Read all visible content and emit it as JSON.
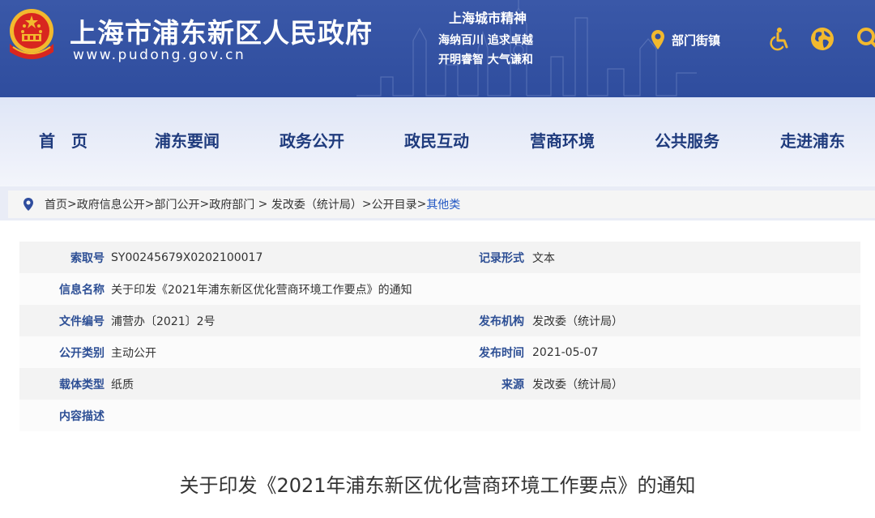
{
  "header": {
    "site_title": "上海市浦东新区人民政府",
    "site_url": "www.pudong.gov.cn",
    "spirit_title": "上海城市精神",
    "spirit_line1": "海纳百川  追求卓越",
    "spirit_line2": "开明睿智  大气谦和",
    "dept_label": "部门街镇",
    "icons": [
      "location-pin-icon",
      "accessibility-icon",
      "globe-icon",
      "search-icon"
    ]
  },
  "nav": {
    "items": [
      "首　页",
      "浦东要闻",
      "政务公开",
      "政民互动",
      "营商环境",
      "公共服务",
      "走进浦东"
    ]
  },
  "breadcrumb": {
    "items": [
      "首页",
      "政府信息公开",
      "部门公开",
      "政府部门 ",
      " 发改委（统计局）",
      "公开目录"
    ],
    "current": "其他类"
  },
  "info": {
    "rows": [
      {
        "label1": "索取号",
        "value1": "SY00245679X0202100017",
        "label2": "记录形式",
        "value2": "文本"
      },
      {
        "label1": "信息名称",
        "value1": "关于印发《2021年浦东新区优化营商环境工作要点》的通知",
        "label2": "",
        "value2": ""
      },
      {
        "label1": "文件编号",
        "value1": "浦营办〔2021〕2号",
        "label2": "发布机构",
        "value2": "发改委（统计局）"
      },
      {
        "label1": "公开类别",
        "value1": "主动公开",
        "label2": "发布时间",
        "value2": "2021-05-07"
      },
      {
        "label1": "载体类型",
        "value1": "纸质",
        "label2": "来源",
        "value2": "发改委（统计局）"
      },
      {
        "label1": "内容描述",
        "value1": "",
        "label2": "",
        "value2": ""
      }
    ]
  },
  "document": {
    "title": "关于印发《2021年浦东新区优化营商环境工作要点》的通知"
  },
  "colors": {
    "header_bg": "#2f4d9e",
    "nav_text": "#1f3b7d",
    "label_blue": "#2d4f95",
    "breadcrumb_current": "#2458c4",
    "accent_gold": "#f2b92e"
  }
}
